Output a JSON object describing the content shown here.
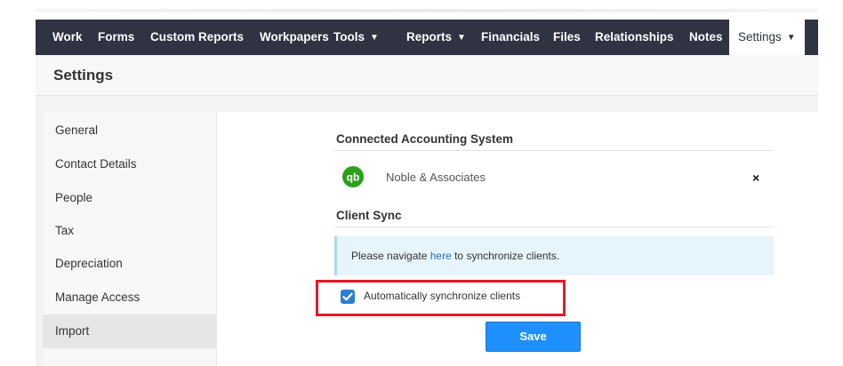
{
  "nav": {
    "items": [
      {
        "label": "Work"
      },
      {
        "label": "Forms"
      },
      {
        "label": "Custom Reports"
      },
      {
        "label": "Workpapers"
      },
      {
        "label": "Tools",
        "caret": "▼"
      },
      {
        "label": "Reports",
        "caret": "▼"
      },
      {
        "label": "Financials"
      },
      {
        "label": "Files"
      },
      {
        "label": "Relationships"
      },
      {
        "label": "Notes"
      },
      {
        "label": "Settings",
        "caret": "▼"
      }
    ]
  },
  "page": {
    "title": "Settings"
  },
  "sidebar": {
    "items": [
      {
        "label": "General"
      },
      {
        "label": "Contact Details"
      },
      {
        "label": "People"
      },
      {
        "label": "Tax"
      },
      {
        "label": "Depreciation"
      },
      {
        "label": "Manage Access"
      },
      {
        "label": "Import"
      }
    ],
    "active_index": 6
  },
  "accounting": {
    "section_title": "Connected Accounting System",
    "logo_icon": "quickbooks-icon",
    "company_name": "Noble & Associates",
    "remove_glyph": "×"
  },
  "client_sync": {
    "section_title": "Client Sync",
    "info_prefix": "Please navigate ",
    "info_link": "here",
    "info_suffix": " to synchronize clients.",
    "checkbox_label": "Automatically synchronize clients",
    "checkbox_checked": true,
    "save_label": "Save"
  },
  "colors": {
    "navbar": "#2f3342",
    "highlight_border": "#e01b2a",
    "button": "#1e90ff",
    "quickbooks_green": "#2ca01c"
  }
}
